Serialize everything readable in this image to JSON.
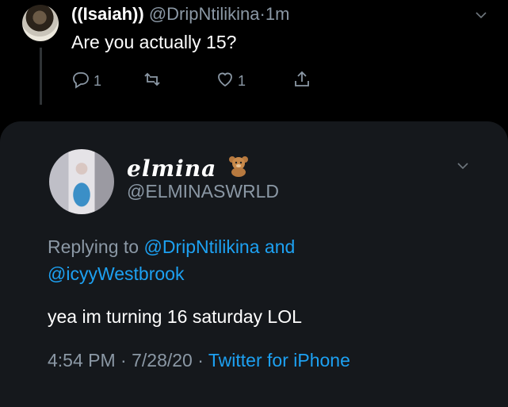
{
  "parent_tweet": {
    "display_name": "((Isaiah))",
    "handle": "@DripNtilikina",
    "separator": "·",
    "time": "1m",
    "text": "Are you actually 15?",
    "reply_count": "1",
    "like_count": "1",
    "icons": [
      "reply-icon",
      "retweet-icon",
      "like-icon",
      "share-icon",
      "chevron-down-icon"
    ]
  },
  "focused_tweet": {
    "display_name": "elmina",
    "emoji": "🧸",
    "handle": "@ELMINASWRLD",
    "replying_prefix": "Replying to",
    "replying_user1": "@DripNtilikina",
    "replying_and": "and",
    "replying_user2": "@icyyWestbrook",
    "text": "yea im turning 16 saturday LOL",
    "time": "4:54 PM",
    "dot": "·",
    "date": "7/28/20",
    "source": "Twitter for iPhone"
  },
  "colors": {
    "background": "#000000",
    "card": "#15181c",
    "secondary_text": "#8b98a5",
    "link": "#1da1f2"
  }
}
